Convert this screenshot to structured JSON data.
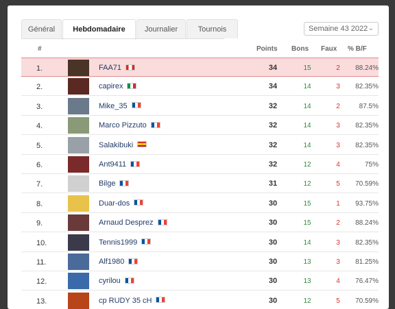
{
  "tabs": [
    {
      "label": "Général"
    },
    {
      "label": "Hebdomadaire"
    },
    {
      "label": "Journalier"
    },
    {
      "label": "Tournois"
    }
  ],
  "week_select": {
    "value": "Semaine 43 2022"
  },
  "columns": {
    "rank": "#",
    "points": "Points",
    "bons": "Bons",
    "faux": "Faux",
    "pct": "% B/F"
  },
  "rows": [
    {
      "rank": "1.",
      "name": "FAA71",
      "flag": "ca",
      "points": "34",
      "bons": "15",
      "faux": "2",
      "pct": "88.24%",
      "avatar": "#4a3428"
    },
    {
      "rank": "2.",
      "name": "capirex",
      "flag": "it",
      "points": "34",
      "bons": "14",
      "faux": "3",
      "pct": "82.35%",
      "avatar": "#5a2a22"
    },
    {
      "rank": "3.",
      "name": "Mike_35",
      "flag": "fr",
      "points": "32",
      "bons": "14",
      "faux": "2",
      "pct": "87.5%",
      "avatar": "#6b7a8a"
    },
    {
      "rank": "4.",
      "name": "Marco Pizzuto",
      "flag": "fr",
      "points": "32",
      "bons": "14",
      "faux": "3",
      "pct": "82.35%",
      "avatar": "#8a9a78"
    },
    {
      "rank": "5.",
      "name": "Salakibuki",
      "flag": "es",
      "points": "32",
      "bons": "14",
      "faux": "3",
      "pct": "82.35%",
      "avatar": "#9aa0a8"
    },
    {
      "rank": "6.",
      "name": "Ant9411",
      "flag": "fr",
      "points": "32",
      "bons": "12",
      "faux": "4",
      "pct": "75%",
      "avatar": "#7a2a2a"
    },
    {
      "rank": "7.",
      "name": "Bilge",
      "flag": "fr",
      "points": "31",
      "bons": "12",
      "faux": "5",
      "pct": "70.59%",
      "avatar": "#d0d0d0"
    },
    {
      "rank": "8.",
      "name": "Duar-dos",
      "flag": "fr",
      "points": "30",
      "bons": "15",
      "faux": "1",
      "pct": "93.75%",
      "avatar": "#e8c24a"
    },
    {
      "rank": "9.",
      "name": "Arnaud Desprez",
      "flag": "fr",
      "points": "30",
      "bons": "15",
      "faux": "2",
      "pct": "88.24%",
      "avatar": "#6a3a3a"
    },
    {
      "rank": "10.",
      "name": "Tennis1999",
      "flag": "fr",
      "points": "30",
      "bons": "14",
      "faux": "3",
      "pct": "82.35%",
      "avatar": "#3a3a4a"
    },
    {
      "rank": "11.",
      "name": "Alf1980",
      "flag": "fr",
      "points": "30",
      "bons": "13",
      "faux": "3",
      "pct": "81.25%",
      "avatar": "#4a6a9a"
    },
    {
      "rank": "12.",
      "name": "cyrilou",
      "flag": "fr",
      "points": "30",
      "bons": "13",
      "faux": "4",
      "pct": "76.47%",
      "avatar": "#3a6aaa"
    },
    {
      "rank": "13.",
      "name": "cp RUDY 35 cH",
      "flag": "fr",
      "points": "30",
      "bons": "12",
      "faux": "5",
      "pct": "70.59%",
      "avatar": "#b8441a"
    }
  ],
  "highlight_row": "1."
}
